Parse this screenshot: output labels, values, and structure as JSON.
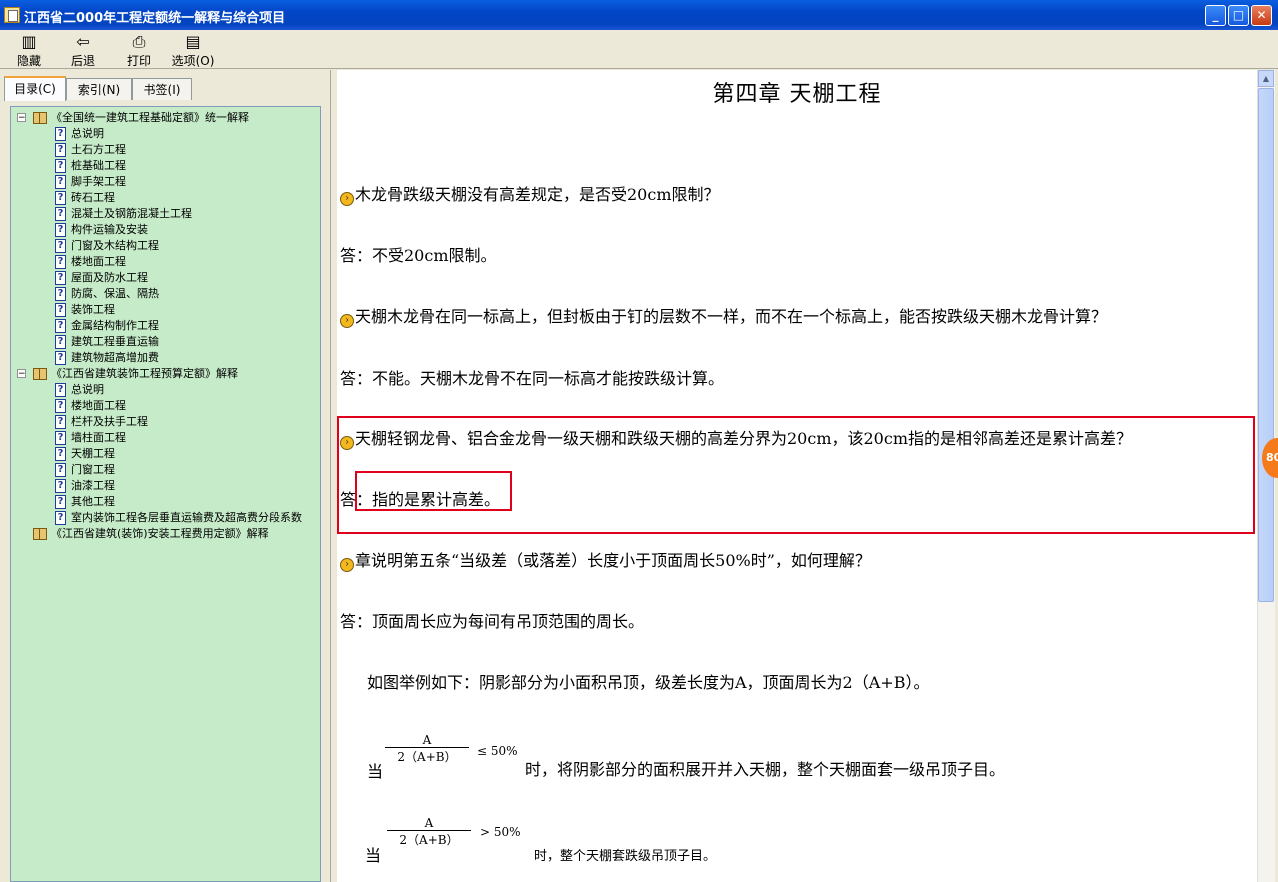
{
  "window": {
    "title": "江西省二000年工程定额统一解释与综合项目",
    "minimize": "_",
    "maximize": "□",
    "close": "✕"
  },
  "toolbar": {
    "hide": "隐藏",
    "back": "后退",
    "print": "打印",
    "options": "选项(O)"
  },
  "tabs": [
    "目录(C)",
    "索引(N)",
    "书签(I)"
  ],
  "tree": {
    "book1": "《全国统一建筑工程基础定额》统一解释",
    "book1_items": [
      "总说明",
      "土石方工程",
      "桩基础工程",
      "脚手架工程",
      "砖石工程",
      "混凝土及钢筋混凝土工程",
      "构件运输及安装",
      "门窗及木结构工程",
      "楼地面工程",
      "屋面及防水工程",
      "防腐、保温、隔热",
      "装饰工程",
      "金属结构制作工程",
      "建筑工程垂直运输",
      "建筑物超高增加费"
    ],
    "book2": "《江西省建筑装饰工程预算定额》解释",
    "book2_items": [
      "总说明",
      "楼地面工程",
      "栏杆及扶手工程",
      "墙柱面工程",
      "天棚工程",
      "门窗工程",
      "油漆工程",
      "其他工程",
      "室内装饰工程各层垂直运输费及超高费分段系数"
    ],
    "book3": "《江西省建筑(装饰)安装工程费用定额》解释"
  },
  "content": {
    "chapter_title": "第四章  天棚工程",
    "q1": "木龙骨跌级天棚没有高差规定，是否受20cm限制？",
    "a1": "答：不受20cm限制。",
    "q2": "天棚木龙骨在同一标高上，但封板由于钉的层数不一样，而不在一个标高上，能否按跌级天棚木龙骨计算？",
    "a2": "答：不能。天棚木龙骨不在同一标高才能按跌级计算。",
    "q3": "天棚轻钢龙骨、铝合金龙骨一级天棚和跌级天棚的高差分界为20cm，该20cm指的是相邻高差还是累计高差？",
    "a3_prefix": "答",
    "a3_answer": "：指的是累计高差",
    "a3_suffix": "。",
    "q4": "章说明第五条“当级差（或落差）长度小于顶面周长50%时”，如何理解？",
    "a4": "答：顶面周长应为每间有吊顶范围的周长。",
    "example": "如图举例如下：阴影部分为小面积吊顶，级差长度为A，顶面周长为2（A+B）。",
    "f1_dang": "当",
    "f1_num": "A",
    "f1_den": "2（A+B）",
    "f1_cmp": "≤ 50%",
    "f1_text": "时，将阴影部分的面积展开并入天棚，整个天棚面套一级吊顶子目。",
    "f2_dang": "当",
    "f2_num": "A",
    "f2_den": "2（A+B）",
    "f2_cmp": "> 50%",
    "f2_text": "时，整个天棚套跌级吊顶子目。"
  },
  "badge": "80"
}
